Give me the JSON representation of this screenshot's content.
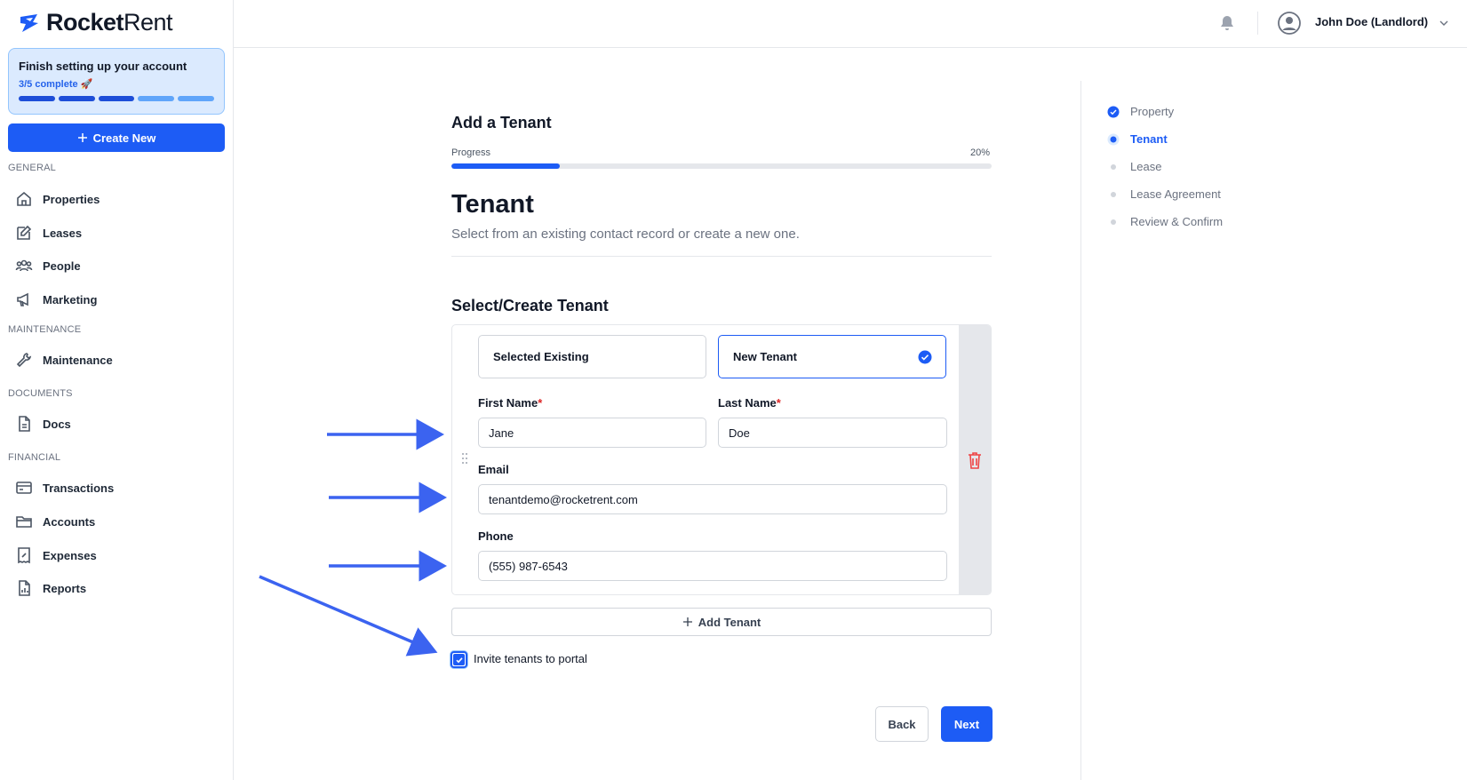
{
  "brand": {
    "name_bold": "Rocket",
    "name_light": "Rent"
  },
  "setup": {
    "title": "Finish setting up your account",
    "progress_text": "3/5 complete 🚀",
    "completed_steps": 3,
    "total_steps": 5,
    "colors": {
      "done": "#1d4ed8",
      "pending": "#60a5fa"
    }
  },
  "sidebar": {
    "create_label": "Create New",
    "sections": {
      "general": "GENERAL",
      "maintenance": "MAINTENANCE",
      "documents": "DOCUMENTS",
      "financial": "FINANCIAL"
    },
    "items": {
      "properties": "Properties",
      "leases": "Leases",
      "people": "People",
      "marketing": "Marketing",
      "maintenance": "Maintenance",
      "docs": "Docs",
      "transactions": "Transactions",
      "accounts": "Accounts",
      "expenses": "Expenses",
      "reports": "Reports"
    }
  },
  "header": {
    "user_name": "John Doe (Landlord)"
  },
  "main": {
    "title": "Add a Tenant",
    "progress_label": "Progress",
    "progress_percent_text": "20%",
    "progress_value": 0.2,
    "heading": "Tenant",
    "description": "Select from an existing contact record or create a new one.",
    "section_title": "Select/Create Tenant",
    "options": {
      "existing": "Selected Existing",
      "new": "New Tenant"
    },
    "selected_option": "new",
    "fields": {
      "first_name": {
        "label": "First Name",
        "value": "Jane",
        "required": "*"
      },
      "last_name": {
        "label": "Last Name",
        "value": "Doe",
        "required": "*"
      },
      "email": {
        "label": "Email",
        "value": "tenantdemo@rocketrent.com"
      },
      "phone": {
        "label": "Phone",
        "value": "(555) 987-6543"
      }
    },
    "add_tenant_label": "Add Tenant",
    "invite_label": "Invite tenants to portal",
    "invite_checked": true,
    "back_label": "Back",
    "next_label": "Next"
  },
  "steps": [
    {
      "label": "Property",
      "state": "done"
    },
    {
      "label": "Tenant",
      "state": "active"
    },
    {
      "label": "Lease",
      "state": "pending"
    },
    {
      "label": "Lease Agreement",
      "state": "pending"
    },
    {
      "label": "Review & Confirm",
      "state": "pending"
    }
  ],
  "colors": {
    "primary": "#1d5cf5",
    "annotation_arrow": "#3b63f0",
    "danger": "#dc2626"
  }
}
